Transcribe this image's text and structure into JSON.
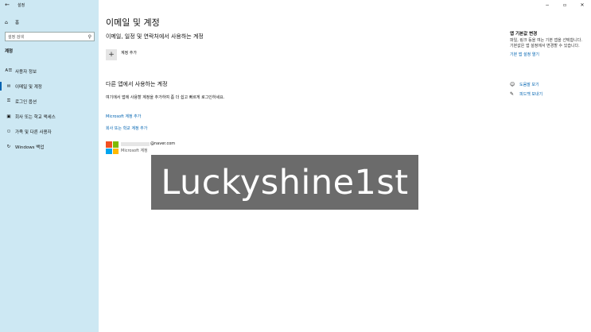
{
  "window": {
    "app_title": "설정",
    "back_icon": "←",
    "minimize_icon": "−",
    "maximize_icon": "▫",
    "close_icon": "✕"
  },
  "sidebar": {
    "home_label": "홈",
    "home_icon": "⌂",
    "search_placeholder": "설정 검색",
    "search_icon": "⚲",
    "section_title": "계정",
    "items": [
      {
        "icon": "Ꭺ☰",
        "label": "사용자 정보",
        "active": false
      },
      {
        "icon": "✉",
        "label": "이메일 및 계정",
        "active": true
      },
      {
        "icon": "⚿",
        "label": "로그인 옵션",
        "active": false
      },
      {
        "icon": "▣",
        "label": "회사 또는 학교 액세스",
        "active": false
      },
      {
        "icon": "⚇",
        "label": "가족 및 다른 사용자",
        "active": false
      },
      {
        "icon": "↻",
        "label": "Windows 백업",
        "active": false
      }
    ]
  },
  "main": {
    "title": "이메일 및 계정",
    "section1_title": "이메일, 일정 및 연락처에서 사용하는 계정",
    "add_account_plus": "+",
    "add_account_label": "계정 추가",
    "section2_title": "다른 앱에서 사용하는 계정",
    "section2_desc": "여기에서 앱에 사용할 계정을 추가하여 좀 더 쉽고 빠르게 로그인하세요.",
    "link_ms_account": "Microsoft 계정 추가",
    "link_work_account": "회사 또는 학교 계정 추가",
    "account": {
      "email_suffix": "@naver.com",
      "type": "Microsoft 계정"
    },
    "watermark_text": "Luckyshine1st"
  },
  "related": {
    "title": "앱 기본값 변경",
    "desc": "파일, 링크 등을 여는 기본 앱을 선택합니다. 기본값은 앱 설정에서 변경할 수 있습니다.",
    "link": "기본 앱 설정 열기"
  },
  "help": {
    "get_help": "도움말 보기",
    "get_help_icon": "☺",
    "feedback": "피드백 보내기",
    "feedback_icon": "✎"
  },
  "colors": {
    "sidebar_bg": "#cde8f3",
    "accent": "#0063b1",
    "ms_red": "#f25022",
    "ms_green": "#7fba00",
    "ms_blue": "#00a4ef",
    "ms_yellow": "#ffb900"
  }
}
